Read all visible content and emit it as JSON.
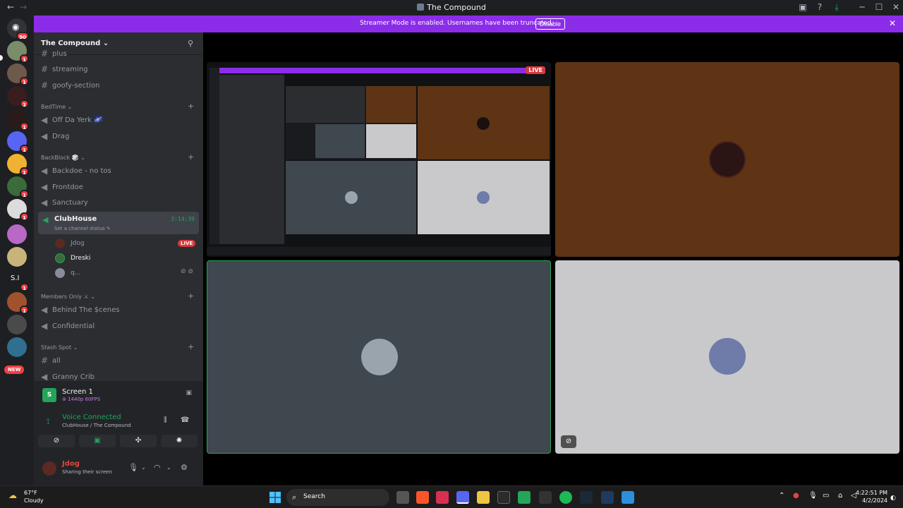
{
  "window": {
    "title": "The Compound",
    "back": "←",
    "forward": "→",
    "min": "─",
    "max": "☐",
    "close": "✕"
  },
  "guilds": {
    "home_badge": "90",
    "unread": "1",
    "s_label": "S.I",
    "new_label": "NEW"
  },
  "banner": {
    "text": "Streamer Mode is enabled. Usernames have been truncated.",
    "button": "Disable",
    "close": "✕"
  },
  "server": {
    "name": "The Compound",
    "chevron": "⌄"
  },
  "channels": {
    "partial_top": "plus",
    "streaming": "streaming",
    "goofy": "goofy-section",
    "cat_bedtime": "BedTime",
    "off_da_yerk": "Off Da Yerk 🌌",
    "drag": "Drag",
    "cat_backblock": "BackBlock 🎲",
    "backdoe": "Backdoe - no tos",
    "frontdoe": "Frontdoe",
    "sanctuary": "Sanctuary",
    "clubhouse": "ClubHouse",
    "clubhouse_time": "3:14:39",
    "clubhouse_status": "Set a channel status ✎",
    "cat_members": "Members Only ⚔",
    "behind": "Behind The $cenes",
    "confidential": "Confidential",
    "cat_stash": "Stash Spot",
    "all": "all",
    "granny": "Granny Crib"
  },
  "voice_users": [
    {
      "name": "Jdog",
      "live": "LIVE"
    },
    {
      "name": "Dreski"
    },
    {
      "name": "q..."
    }
  ],
  "panel": {
    "screen_title": "Screen 1",
    "screen_meta": "⊚ 1440p 60FPS",
    "voice_connected": "Voice Connected",
    "voice_location": "ClubHouse / The Compound",
    "user_name": "Jdog",
    "user_status": "Sharing their screen"
  },
  "stage": {
    "live": "LIVE"
  },
  "taskbar": {
    "temp": "67°F",
    "weather": "Cloudy",
    "search": "Search",
    "time": "4:22:51 PM",
    "date": "4/2/2024"
  },
  "colors": {
    "banner": "#8b2de8",
    "live": "#da373c",
    "connected": "#23a55a",
    "tile_brown": "#5e3414",
    "tile_slate": "#3f474f",
    "tile_light": "#c9c9cb"
  }
}
